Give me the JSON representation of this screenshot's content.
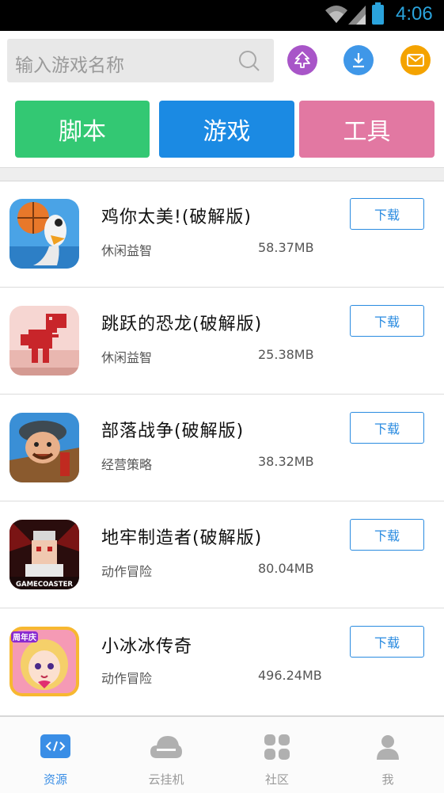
{
  "status_bar": {
    "time": "4:06"
  },
  "search": {
    "placeholder": "输入游戏名称"
  },
  "header_icons": [
    "tree-icon",
    "download-icon",
    "mail-icon"
  ],
  "categories": [
    {
      "label": "脚本",
      "color": "#33c873"
    },
    {
      "label": "游戏",
      "color": "#1b8ae3"
    },
    {
      "label": "工具",
      "color": "#e278a2"
    }
  ],
  "apps": [
    {
      "title": "鸡你太美!(破解版)",
      "category": "休闲益智",
      "size": "58.37MB",
      "button": "下载",
      "icon": "chicken-basketball-icon"
    },
    {
      "title": "跳跃的恐龙(破解版)",
      "category": "休闲益智",
      "size": "25.38MB",
      "button": "下载",
      "icon": "pixel-dinosaur-icon"
    },
    {
      "title": "部落战争(破解版)",
      "category": "经营策略",
      "size": "38.32MB",
      "button": "下载",
      "icon": "warrior-icon"
    },
    {
      "title": "地牢制造者(破解版)",
      "category": "动作冒险",
      "size": "80.04MB",
      "button": "下载",
      "icon": "dungeon-maker-icon",
      "icon_text": "GAMECOASTER"
    },
    {
      "title": "小冰冰传奇",
      "category": "动作冒险",
      "size": "496.24MB",
      "button": "下载",
      "icon": "anime-girl-icon",
      "icon_text": "周年庆"
    }
  ],
  "bottom_nav": [
    {
      "label": "资源",
      "active": true,
      "icon": "code-icon"
    },
    {
      "label": "云挂机",
      "active": false,
      "icon": "cloud-icon"
    },
    {
      "label": "社区",
      "active": false,
      "icon": "grid-icon"
    },
    {
      "label": "我",
      "active": false,
      "icon": "person-icon"
    }
  ]
}
